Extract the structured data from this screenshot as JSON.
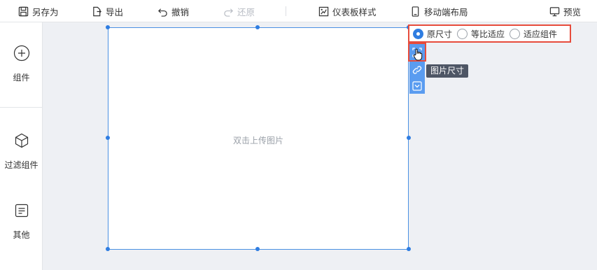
{
  "toolbar": {
    "save_as": "另存为",
    "export": "导出",
    "undo": "撤销",
    "redo": "还原",
    "dashboard_style": "仪表板样式",
    "mobile_layout": "移动端布局",
    "preview": "预览"
  },
  "sidebar": {
    "items": [
      {
        "label": "组件",
        "icon": "plus-circle-icon"
      },
      {
        "label": "过滤组件",
        "icon": "cube-icon"
      },
      {
        "label": "其他",
        "icon": "document-icon"
      }
    ]
  },
  "widget": {
    "placeholder": "双击上传图片"
  },
  "image_size": {
    "options": [
      "原尺寸",
      "等比适应",
      "适应组件"
    ],
    "selected": "原尺寸"
  },
  "tools": {
    "tooltip": "图片尺寸",
    "items": [
      "image-size-icon",
      "link-icon",
      "dropdown-icon"
    ]
  },
  "colors": {
    "accent": "#2f7de1",
    "highlight": "#e74c3c",
    "tool_strip": "#5a9cf0"
  }
}
